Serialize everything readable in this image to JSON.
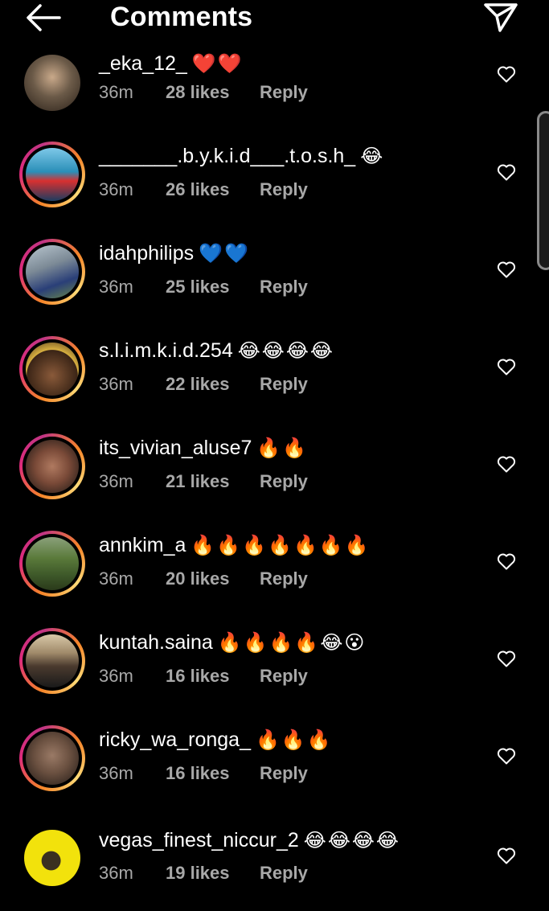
{
  "header": {
    "title": "Comments",
    "back_icon": "arrow-left-icon",
    "send_icon": "paper-plane-icon"
  },
  "comments": [
    {
      "username": "_eka_12_",
      "emojis": "❤️❤️",
      "time": "36m",
      "likes": "28 likes",
      "reply": "Reply",
      "avatar_color": "#6b5a48"
    },
    {
      "username": "_______.b.y.k.i.d___.t.o.s.h_",
      "emojis": "😂",
      "time": "36m",
      "likes": "26 likes",
      "reply": "Reply",
      "avatar_color": "#2a8fb8"
    },
    {
      "username": "idahphilips",
      "emojis": "💙💙",
      "time": "36m",
      "likes": "25 likes",
      "reply": "Reply",
      "avatar_color": "#7c8a96"
    },
    {
      "username": "s.l.i.m.k.i.d.254",
      "emojis": "😂😂😂😂",
      "time": "36m",
      "likes": "22 likes",
      "reply": "Reply",
      "avatar_color": "#3a2416"
    },
    {
      "username": "its_vivian_aluse7",
      "emojis": "🔥🔥",
      "time": "36m",
      "likes": "21 likes",
      "reply": "Reply",
      "avatar_color": "#7a4a38"
    },
    {
      "username": "annkim_a",
      "emojis": "🔥🔥🔥🔥🔥🔥🔥",
      "time": "36m",
      "likes": "20 likes",
      "reply": "Reply",
      "avatar_color": "#3f5a2a"
    },
    {
      "username": "kuntah.saina",
      "emojis": "🔥🔥🔥🔥😂😮",
      "time": "36m",
      "likes": "16 likes",
      "reply": "Reply",
      "avatar_color": "#4a3a2e"
    },
    {
      "username": "ricky_wa_ronga_",
      "emojis": "🔥🔥🔥",
      "time": "36m",
      "likes": "16 likes",
      "reply": "Reply",
      "avatar_color": "#6a5040"
    },
    {
      "username": "vegas_finest_niccur_2",
      "emojis": "😂😂😂😂",
      "time": "36m",
      "likes": "19 likes",
      "reply": "Reply",
      "avatar_color": "#f2e20c"
    }
  ]
}
